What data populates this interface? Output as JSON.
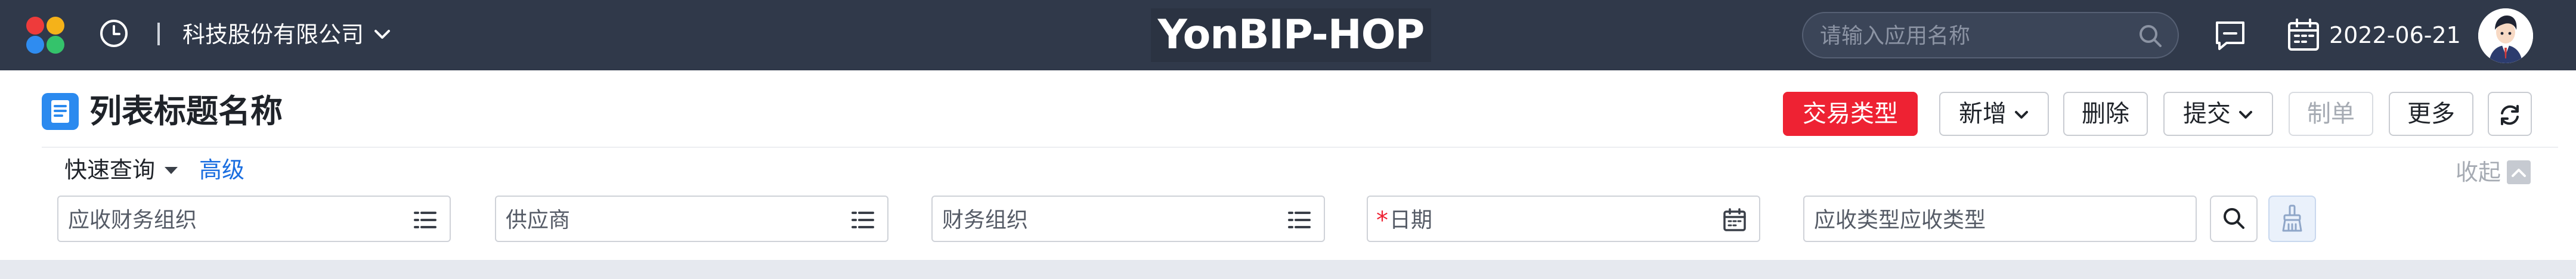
{
  "header": {
    "company": "科技股份有限公司",
    "brand": "YonBIP-HOP",
    "search_placeholder": "请输入应用名称",
    "date": "2022-06-21"
  },
  "page": {
    "title": "列表标题名称"
  },
  "toolbar": {
    "transaction_type": "交易类型",
    "add": "新增",
    "delete": "删除",
    "submit": "提交",
    "make_doc": "制单",
    "more": "更多"
  },
  "query": {
    "quick_query": "快速查询",
    "advanced": "高级",
    "collapse": "收起",
    "fields": {
      "receivable_org": "应收财务组织",
      "supplier": "供应商",
      "finance_org": "财务组织",
      "date": "日期",
      "receivable_type": "应收类型应收类型"
    },
    "required_mark": "*"
  },
  "colors": {
    "topbar_bg": "#30394a",
    "primary_red": "#ee2233",
    "link_blue": "#1a6ee0",
    "title_icon_blue": "#2b8aef"
  },
  "icons": {
    "logo": "petal-logo-icon",
    "recent": "clock-icon",
    "search": "search-icon",
    "message": "message-icon",
    "calendar": "calendar-icon",
    "avatar": "user-avatar",
    "refresh": "refresh-icon",
    "list": "list-icon",
    "clear": "clear-brush-icon"
  }
}
